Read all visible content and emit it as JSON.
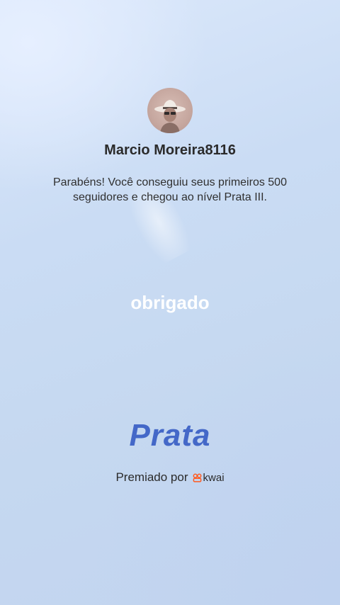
{
  "profile": {
    "username": "Marcio Moreira8116",
    "message": "Parabéns! Você conseguiu seus primeiros 500 seguidores e chegou ao nível Prata III."
  },
  "thanks_label": "obrigado",
  "level_name": "Prata",
  "awarded": {
    "label": "Premiado por",
    "brand": "kwai"
  },
  "colors": {
    "level_text": "#4468c8",
    "brand_icon": "#ff5a1f"
  },
  "icons": {
    "avatar": "avatar",
    "brand_logo": "kwai-logo-icon"
  }
}
